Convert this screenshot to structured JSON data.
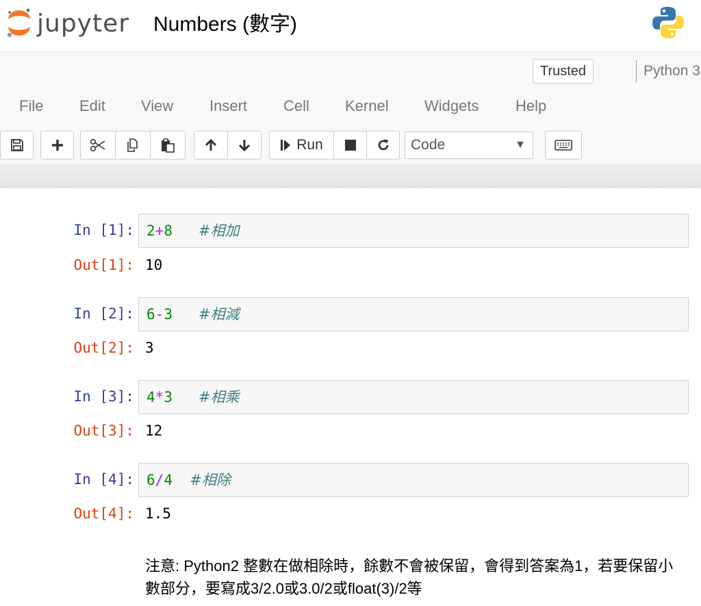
{
  "header": {
    "logo_text": "jupyter",
    "notebook_title": "Numbers (數字)",
    "colors": {
      "logo_orange": "#f37726",
      "python_blue": "#3776ab",
      "python_yellow": "#ffd43b"
    }
  },
  "status": {
    "trusted": "Trusted",
    "kernel": "Python 3"
  },
  "menu": {
    "items": [
      "File",
      "Edit",
      "View",
      "Insert",
      "Cell",
      "Kernel",
      "Widgets",
      "Help"
    ]
  },
  "toolbar": {
    "run_label": "Run",
    "cell_type": "Code",
    "icons": [
      "save-icon",
      "plus-icon",
      "cut-icon",
      "copy-icon",
      "paste-icon",
      "arrow-up-icon",
      "arrow-down-icon",
      "step-forward-icon",
      "stop-icon",
      "restart-icon",
      "keyboard-icon"
    ]
  },
  "cells": [
    {
      "in_prompt": "In [1]:",
      "code_a": "2",
      "op": "+",
      "code_b": "8",
      "spacer": "   ",
      "comment": "#相加",
      "out_prompt": "Out[1]:",
      "output": "10"
    },
    {
      "in_prompt": "In [2]:",
      "code_a": "6",
      "op": "-",
      "code_b": "3",
      "spacer": "   ",
      "comment": "#相減",
      "out_prompt": "Out[2]:",
      "output": "3"
    },
    {
      "in_prompt": "In [3]:",
      "code_a": "4",
      "op": "*",
      "code_b": "3",
      "spacer": "   ",
      "comment": "#相乘",
      "out_prompt": "Out[3]:",
      "output": "12"
    },
    {
      "in_prompt": "In [4]:",
      "code_a": "6",
      "op": "/",
      "code_b": "4",
      "spacer": "  ",
      "comment": "#相除",
      "out_prompt": "Out[4]:",
      "output": "1.5"
    }
  ],
  "note": {
    "text": "注意: Python2 整數在做相除時，餘數不會被保留，會得到答案為1，若要保留小數部分，要寫成3/2.0或3.0/2或float(3)/2等"
  }
}
